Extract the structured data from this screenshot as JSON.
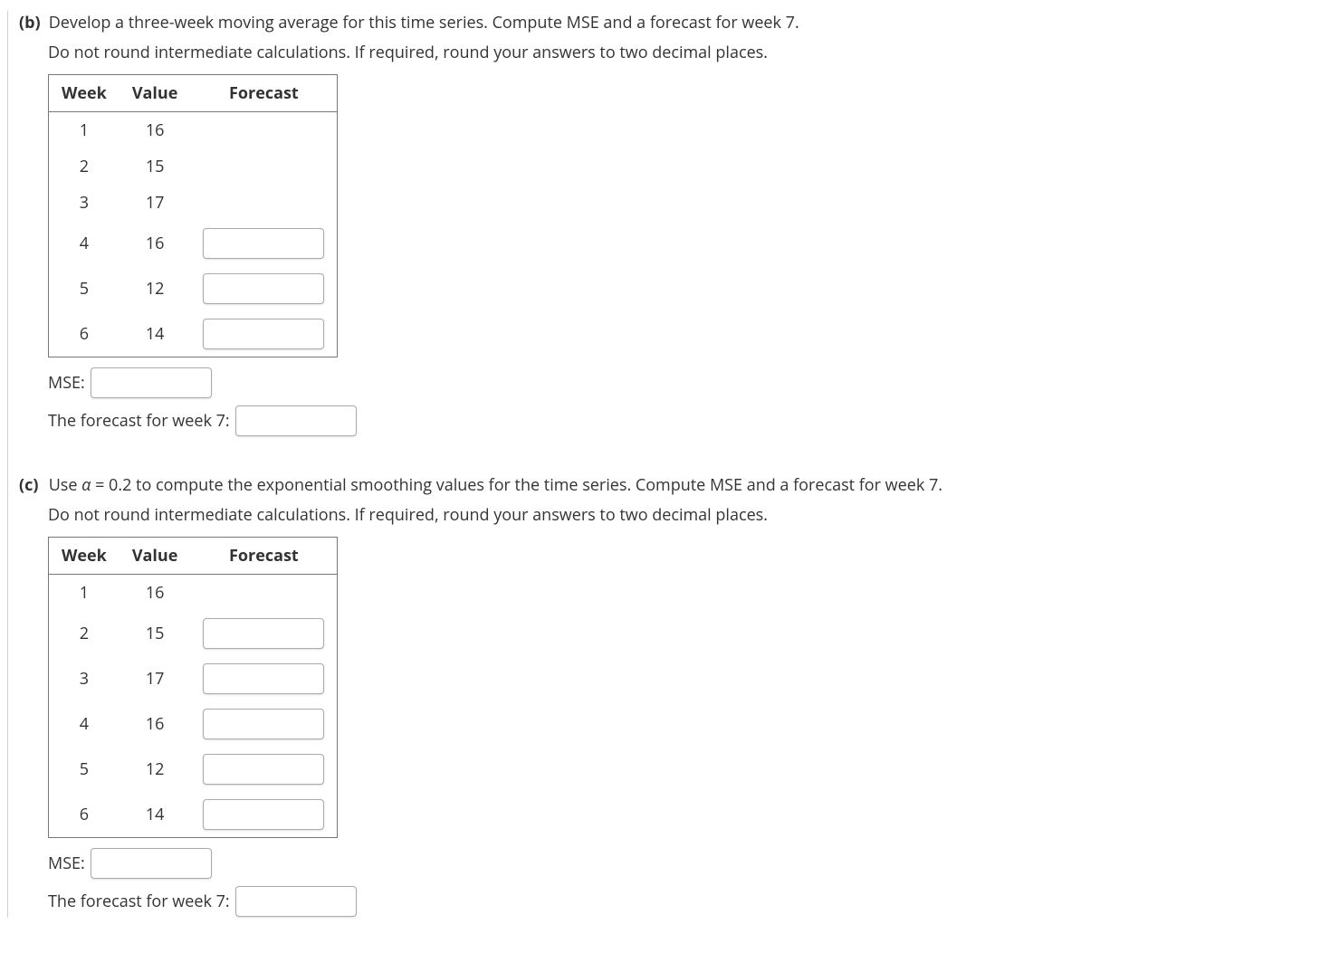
{
  "parts": {
    "b": {
      "label": "(b)",
      "prompt": "Develop a three-week moving average for this time series. Compute MSE and a forecast for week 7.",
      "subprompt": "Do not round intermediate calculations. If required, round your answers to two decimal places.",
      "headers": {
        "week": "Week",
        "value": "Value",
        "forecast": "Forecast"
      },
      "rows": [
        {
          "week": "1",
          "value": "16",
          "forecast_input": false
        },
        {
          "week": "2",
          "value": "15",
          "forecast_input": false
        },
        {
          "week": "3",
          "value": "17",
          "forecast_input": false
        },
        {
          "week": "4",
          "value": "16",
          "forecast_input": true
        },
        {
          "week": "5",
          "value": "12",
          "forecast_input": true
        },
        {
          "week": "6",
          "value": "14",
          "forecast_input": true
        }
      ],
      "mse_label": "MSE:",
      "forecast7_label": "The forecast for week 7:"
    },
    "c": {
      "label": "(c)",
      "prompt_prefix": "Use ",
      "alpha_var": "α",
      "alpha_eq": " = 0.2",
      "prompt_suffix": " to compute the exponential smoothing values for the time series. Compute MSE and a forecast for week 7.",
      "subprompt": "Do not round intermediate calculations. If required, round your answers to two decimal places.",
      "headers": {
        "week": "Week",
        "value": "Value",
        "forecast": "Forecast"
      },
      "rows": [
        {
          "week": "1",
          "value": "16",
          "forecast_input": false
        },
        {
          "week": "2",
          "value": "15",
          "forecast_input": true
        },
        {
          "week": "3",
          "value": "17",
          "forecast_input": true
        },
        {
          "week": "4",
          "value": "16",
          "forecast_input": true
        },
        {
          "week": "5",
          "value": "12",
          "forecast_input": true
        },
        {
          "week": "6",
          "value": "14",
          "forecast_input": true
        }
      ],
      "mse_label": "MSE:",
      "forecast7_label": "The forecast for week 7:"
    }
  }
}
